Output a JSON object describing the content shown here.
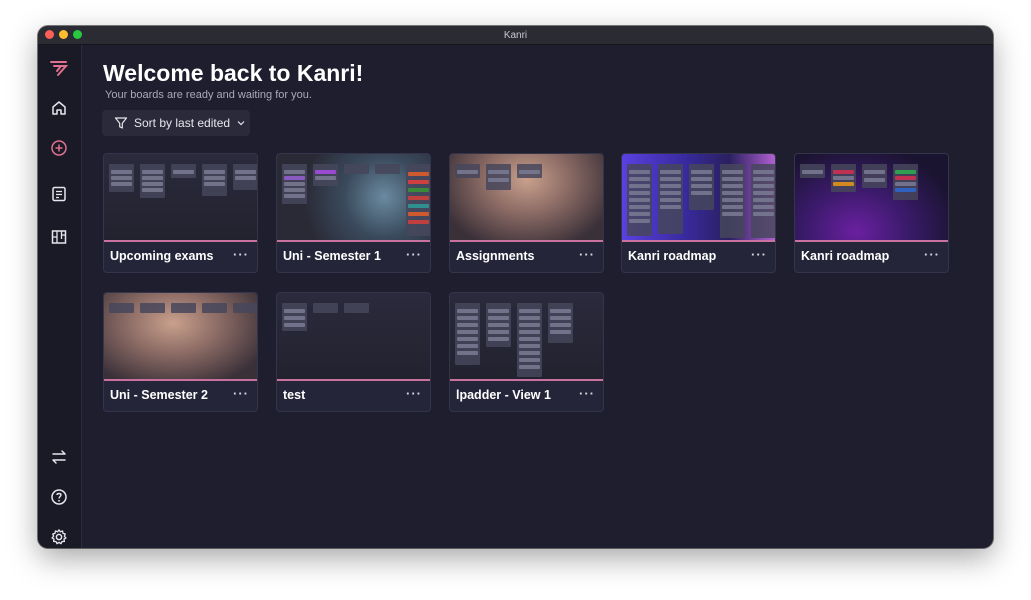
{
  "window": {
    "title": "Kanri"
  },
  "sidebar": {
    "items": [
      {
        "name": "logo-icon"
      },
      {
        "name": "home-icon"
      },
      {
        "name": "add-board-icon"
      },
      {
        "name": "notes-icon"
      },
      {
        "name": "boards-icon"
      },
      {
        "name": "import-export-icon"
      },
      {
        "name": "help-icon"
      },
      {
        "name": "settings-icon"
      }
    ],
    "accent": "#e0708f"
  },
  "main": {
    "title": "Welcome back to Kanri!",
    "subtitle": "Your boards are ready and waiting for you.",
    "sort_label": "Sort by last edited"
  },
  "boards": [
    {
      "name": "Upcoming exams",
      "theme": "dark"
    },
    {
      "name": "Uni - Semester 1",
      "theme": "photo-blur"
    },
    {
      "name": "Assignments",
      "theme": "photo-warm"
    },
    {
      "name": "Kanri roadmap",
      "theme": "purple-blue"
    },
    {
      "name": "Kanri roadmap",
      "theme": "purple-dark"
    },
    {
      "name": "Uni - Semester 2",
      "theme": "photo-warm"
    },
    {
      "name": "test",
      "theme": "dark"
    },
    {
      "name": "lpadder - View 1",
      "theme": "dark"
    }
  ],
  "card_menu_label": "···"
}
